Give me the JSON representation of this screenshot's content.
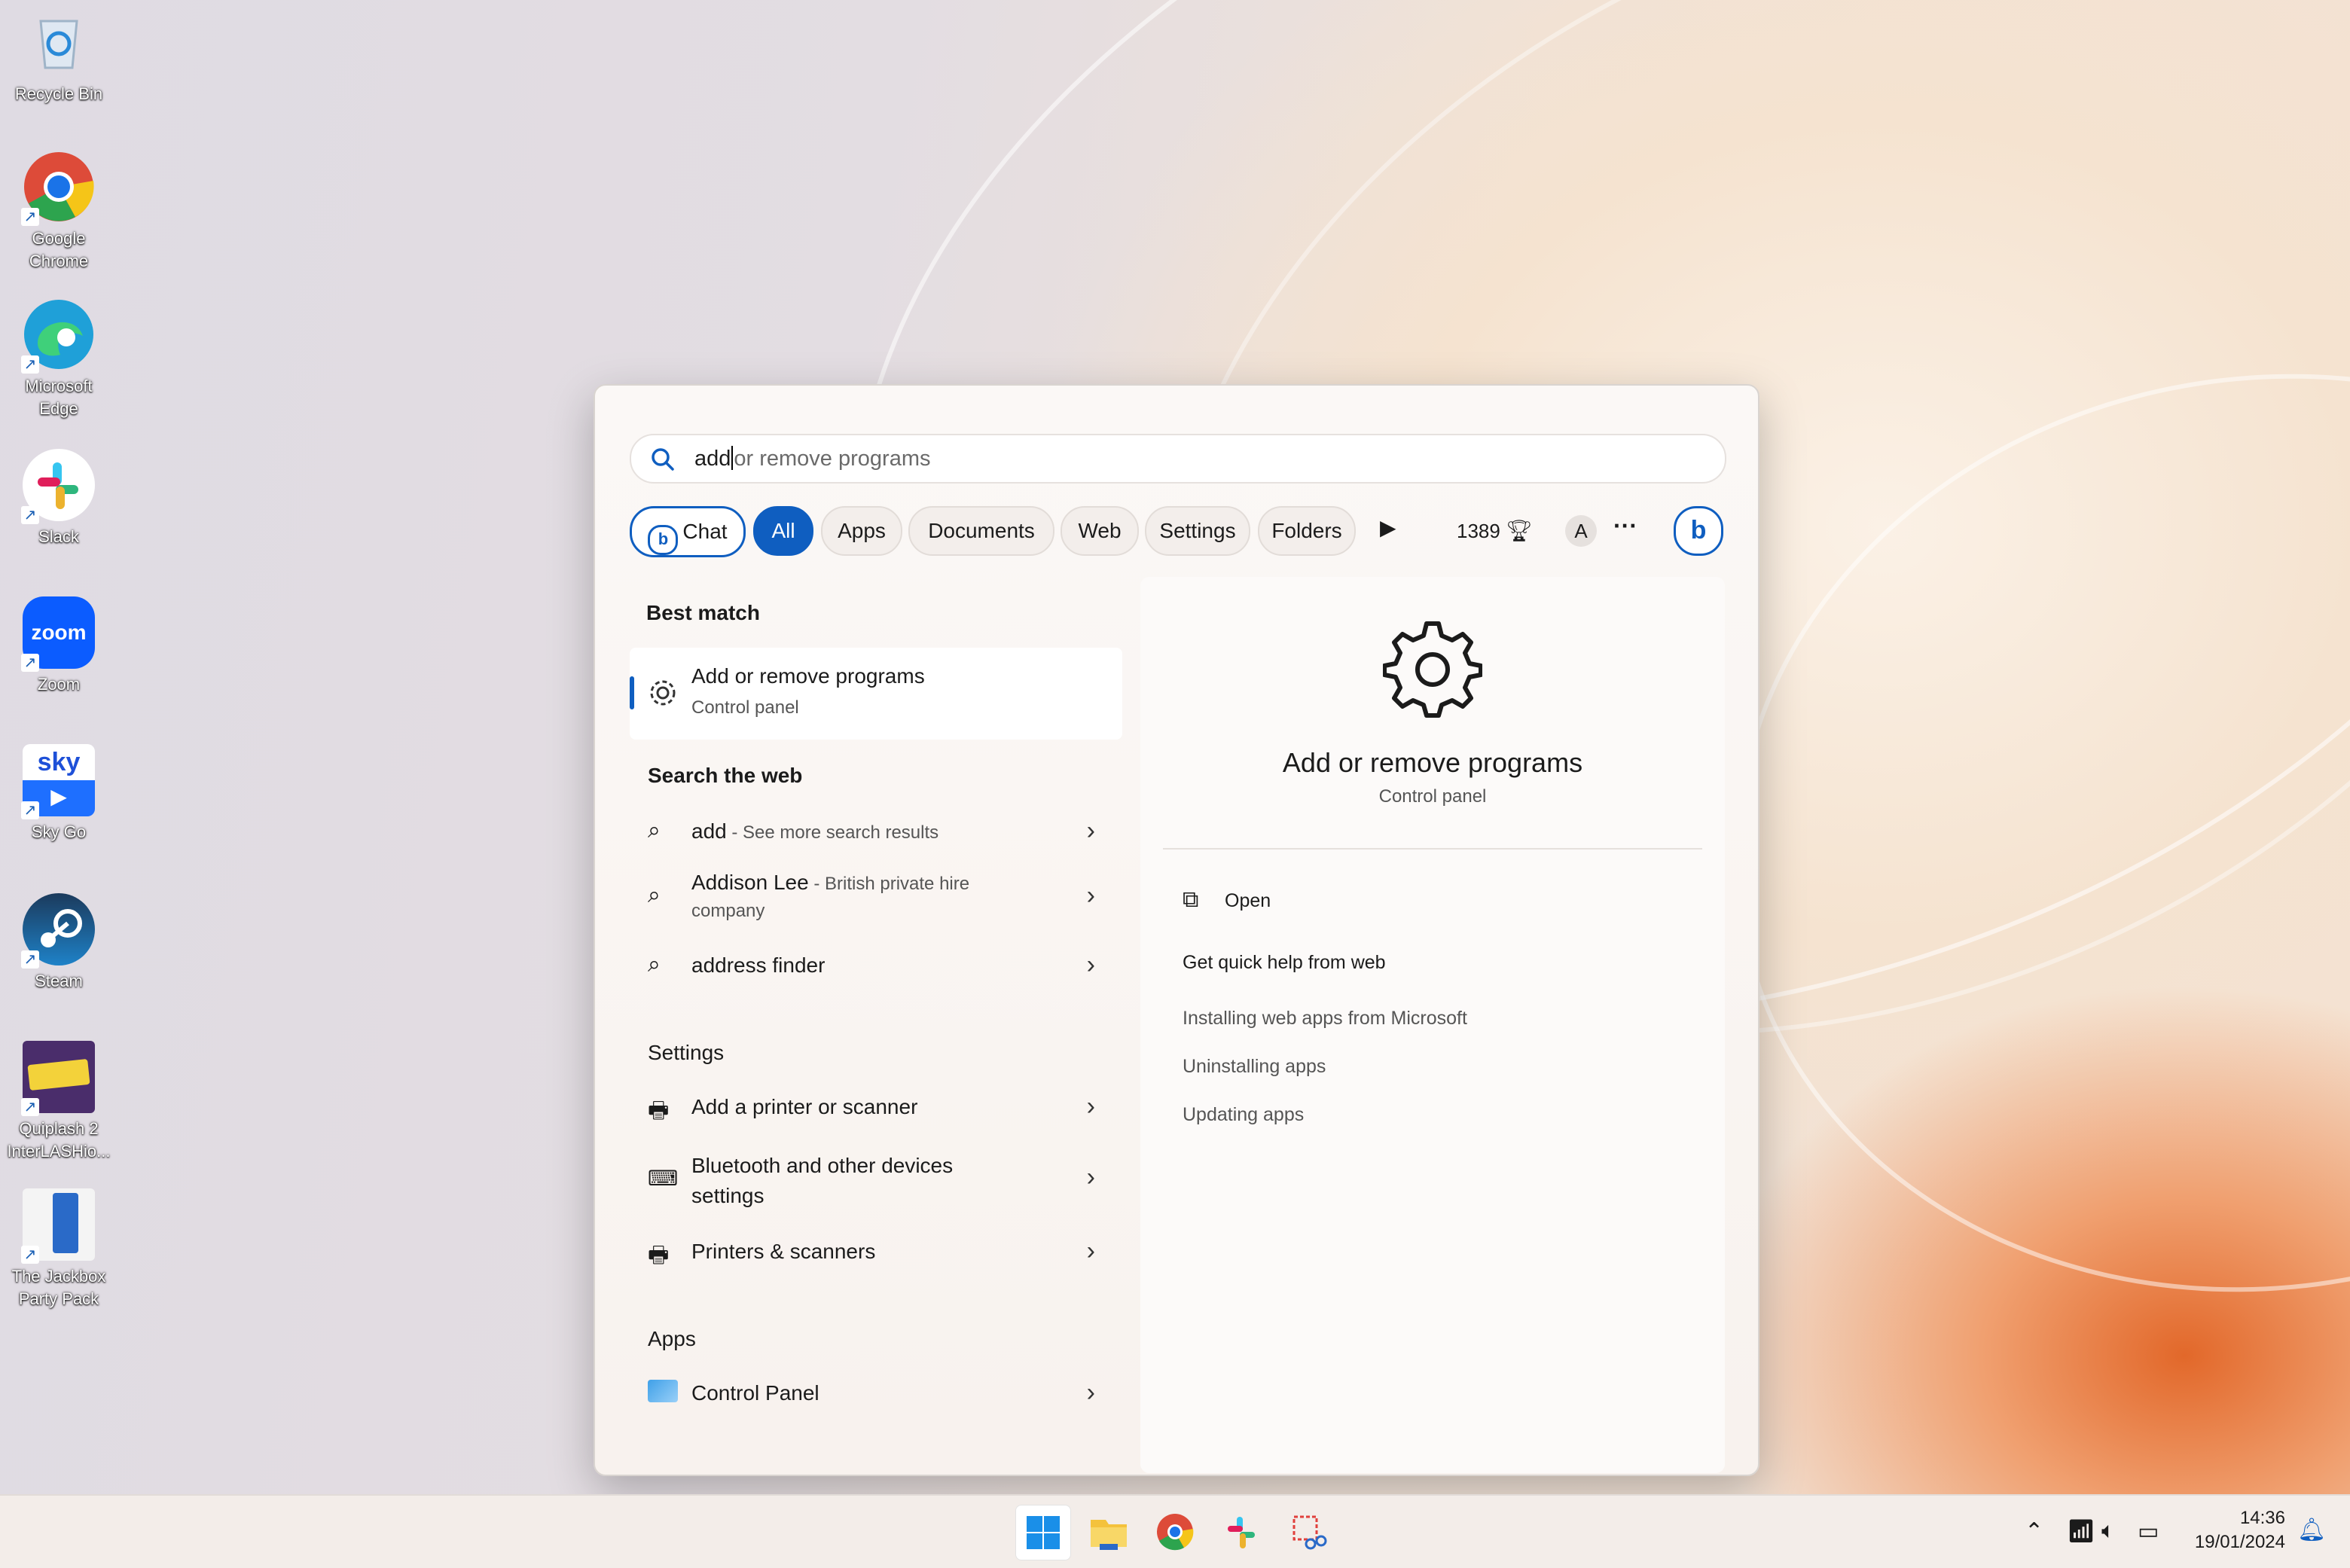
{
  "desktop_icons": [
    {
      "label": "Recycle Bin",
      "icon": "recycle-bin-icon"
    },
    {
      "label": "Google Chrome",
      "icon": "chrome-icon"
    },
    {
      "label": "Microsoft Edge",
      "icon": "edge-icon"
    },
    {
      "label": "Slack",
      "icon": "slack-icon"
    },
    {
      "label": "Zoom",
      "icon": "zoom-icon",
      "text": "zoom"
    },
    {
      "label": "Sky Go",
      "icon": "sky-go-icon",
      "text": "sky"
    },
    {
      "label": "Steam",
      "icon": "steam-icon"
    },
    {
      "label": "Quiplash 2 InterLASHio...",
      "icon": "quiplash-icon"
    },
    {
      "label": "The Jackbox Party Pack",
      "icon": "jackbox-icon"
    }
  ],
  "search": {
    "typed": "add",
    "suggestion": "or remove programs"
  },
  "filters": {
    "chat": "Chat",
    "all": "All",
    "apps": "Apps",
    "documents": "Documents",
    "web": "Web",
    "settings": "Settings",
    "folders": "Folders",
    "points": "1389",
    "avatar": "A",
    "more": "···"
  },
  "results": {
    "best_match_heading": "Best match",
    "best_match": {
      "title_bold": "Add",
      "title_rest": " or remove programs",
      "subtitle": "Control panel"
    },
    "web_heading": "Search the web",
    "web": [
      {
        "bold": "add",
        "rest": " - See more search results",
        "rest2": ""
      },
      {
        "bold": "Addison Lee",
        "rest": " - British private hire",
        "rest2": "company"
      },
      {
        "bold": "address finder",
        "rest": "",
        "rest2": ""
      }
    ],
    "settings_heading": "Settings",
    "settings": [
      {
        "bold": "Add",
        "rest": " a printer or scanner",
        "line2": ""
      },
      {
        "bold": "",
        "rest": "Bluetooth and other devices",
        "line2": "settings"
      },
      {
        "bold": "",
        "rest": "Printers & scanners",
        "line2": ""
      }
    ],
    "apps_heading": "Apps",
    "apps": [
      {
        "label": "Control Panel"
      }
    ]
  },
  "preview": {
    "title": "Add or remove programs",
    "subtitle": "Control panel",
    "open": "Open",
    "quick_help": "Get quick help from web",
    "links": [
      "Installing web apps from Microsoft",
      "Uninstalling apps",
      "Updating apps"
    ]
  },
  "taskbar": {
    "time": "14:36",
    "date": "19/01/2024"
  },
  "colors": {
    "accent": "#0f5ec0"
  }
}
